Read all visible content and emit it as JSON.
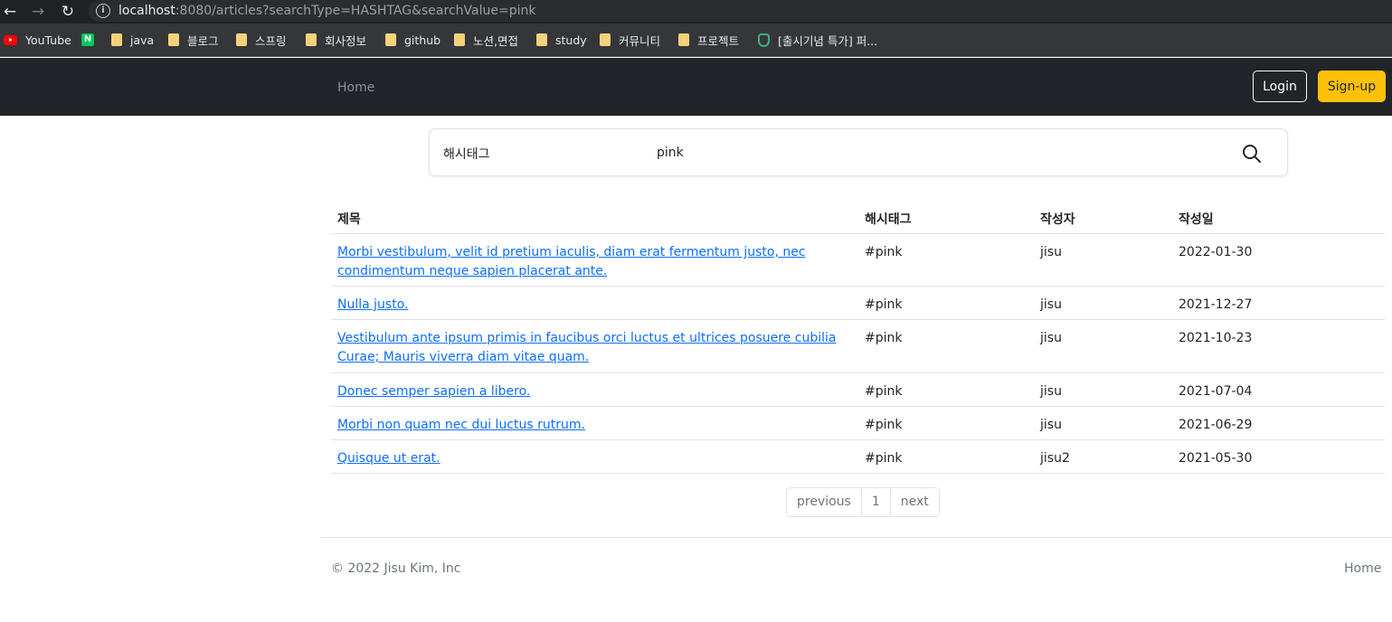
{
  "browser": {
    "url_host": "localhost",
    "url_rest": ":8080/articles?searchType=HASHTAG&searchValue=pink",
    "bookmarks": [
      {
        "label": "YouTube",
        "icon": "youtube-icon"
      },
      {
        "label": "",
        "icon": "naver-icon"
      },
      {
        "label": "java",
        "icon": "folder-icon"
      },
      {
        "label": "블로그",
        "icon": "folder-icon"
      },
      {
        "label": "스프링",
        "icon": "folder-icon"
      },
      {
        "label": "회사정보",
        "icon": "folder-icon"
      },
      {
        "label": "github",
        "icon": "folder-icon"
      },
      {
        "label": "노션,면접",
        "icon": "folder-icon"
      },
      {
        "label": "study",
        "icon": "folder-icon"
      },
      {
        "label": "커뮤니티",
        "icon": "folder-icon"
      },
      {
        "label": "프로젝트",
        "icon": "folder-icon"
      },
      {
        "label": "[출시기념 특가] 퍼...",
        "icon": "shield-icon"
      }
    ]
  },
  "navbar": {
    "home": "Home",
    "login": "Login",
    "signup": "Sign-up"
  },
  "search": {
    "type": "해시태그",
    "value": "pink"
  },
  "table": {
    "headers": {
      "title": "제목",
      "hashtag": "해시태그",
      "author": "작성자",
      "date": "작성일"
    },
    "rows": [
      {
        "title": "Morbi vestibulum, velit id pretium iaculis, diam erat fermentum justo, nec condimentum neque sapien placerat ante.",
        "hashtag": "#pink",
        "author": "jisu",
        "date": "2022-01-30"
      },
      {
        "title": "Nulla justo.",
        "hashtag": "#pink",
        "author": "jisu",
        "date": "2021-12-27"
      },
      {
        "title": "Vestibulum ante ipsum primis in faucibus orci luctus et ultrices posuere cubilia Curae; Mauris viverra diam vitae quam.",
        "hashtag": "#pink",
        "author": "jisu",
        "date": "2021-10-23"
      },
      {
        "title": "Donec semper sapien a libero.",
        "hashtag": "#pink",
        "author": "jisu",
        "date": "2021-07-04"
      },
      {
        "title": "Morbi non quam nec dui luctus rutrum.",
        "hashtag": "#pink",
        "author": "jisu",
        "date": "2021-06-29"
      },
      {
        "title": "Quisque ut erat.",
        "hashtag": "#pink",
        "author": "jisu2",
        "date": "2021-05-30"
      }
    ]
  },
  "pagination": {
    "previous": "previous",
    "page": "1",
    "next": "next"
  },
  "footer": {
    "copyright": "© 2022 Jisu Kim, Inc",
    "home": "Home"
  },
  "colors": {
    "navbar": "#212529",
    "signup": "#ffc107",
    "link": "#0d6efd"
  }
}
